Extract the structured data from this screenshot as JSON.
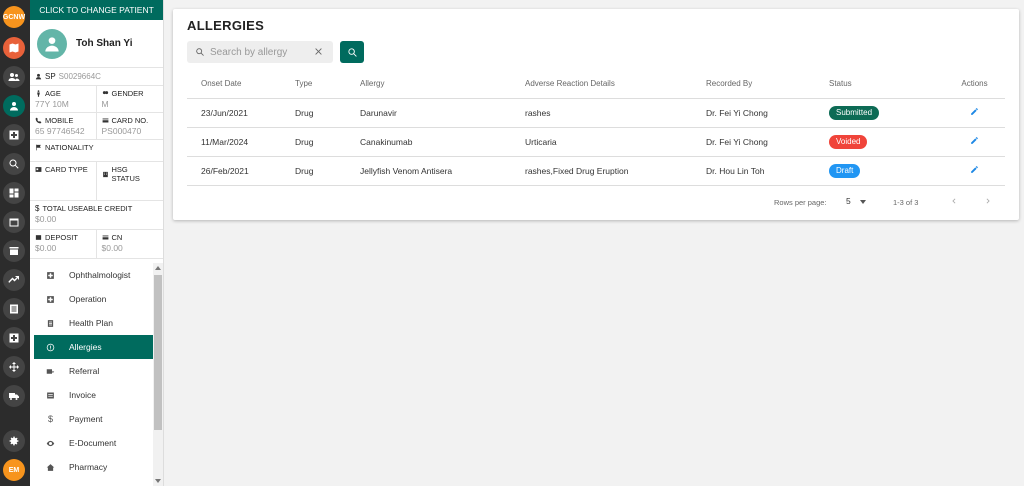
{
  "rail": {
    "top_badge": "GCNW",
    "user_badge": "EM",
    "icons": [
      "map-icon",
      "people-icon",
      "person-icon",
      "medical-plus-icon",
      "search-icon",
      "dashboard-icon",
      "calendar-icon",
      "store-icon",
      "trending-icon",
      "list-icon",
      "hospital-icon",
      "move-icon",
      "truck-icon",
      "settings-icon"
    ]
  },
  "patient": {
    "change_label": "CLICK TO CHANGE PATIENT",
    "name": "Toh Shan Yi",
    "sp_label": "SP",
    "sp_value": "S0029664C",
    "age_label": "AGE",
    "age_value": "77Y 10M",
    "gender_label": "GENDER",
    "gender_value": "M",
    "mobile_label": "MOBILE",
    "mobile_value": "65 97746542",
    "card_no_label": "CARD NO.",
    "card_no_value": "PS000470",
    "nationality_label": "NATIONALITY",
    "card_type_label": "CARD TYPE",
    "hsg_status_label": "HSG STATUS",
    "credit_label": "TOTAL USEABLE CREDIT",
    "credit_value": "$0.00",
    "deposit_label": "DEPOSIT",
    "deposit_value": "$0.00",
    "cn_label": "CN",
    "cn_value": "$0.00"
  },
  "menu": [
    {
      "label": "Ophthalmologist",
      "icon": "medical-plus-icon"
    },
    {
      "label": "Operation",
      "icon": "medical-plus-icon"
    },
    {
      "label": "Health Plan",
      "icon": "clipboard-icon"
    },
    {
      "label": "Allergies",
      "icon": "alert-circle-icon",
      "active": true
    },
    {
      "label": "Referral",
      "icon": "referral-icon"
    },
    {
      "label": "Invoice",
      "icon": "invoice-icon"
    },
    {
      "label": "Payment",
      "icon": "dollar-icon"
    },
    {
      "label": "E-Document",
      "icon": "eye-icon"
    },
    {
      "label": "Pharmacy",
      "icon": "home-icon"
    }
  ],
  "main": {
    "title": "ALLERGIES",
    "search_placeholder": "Search by allergy",
    "columns": [
      "Onset Date",
      "Type",
      "Allergy",
      "Adverse Reaction Details",
      "Recorded By",
      "Status",
      "Actions"
    ],
    "rows": [
      {
        "onset": "23/Jun/2021",
        "type": "Drug",
        "allergy": "Darunavir",
        "reaction": "rashes",
        "recorded_by": "Dr. Fei Yi Chong",
        "status": "Submitted"
      },
      {
        "onset": "11/Mar/2024",
        "type": "Drug",
        "allergy": "Canakinumab",
        "reaction": "Urticaria",
        "recorded_by": "Dr. Fei Yi Chong",
        "status": "Voided"
      },
      {
        "onset": "26/Feb/2021",
        "type": "Drug",
        "allergy": "Jellyfish Venom Antisera",
        "reaction": "rashes,Fixed Drug Eruption",
        "recorded_by": "Dr. Hou Lin Toh",
        "status": "Draft"
      }
    ],
    "status_colors": {
      "Submitted": "#0d6b55",
      "Voided": "#f0443a",
      "Draft": "#2196f3"
    },
    "pager": {
      "rows_per_page_label": "Rows per page:",
      "rows_per_page_value": "5",
      "range": "1-3 of 3"
    }
  },
  "colors": {
    "accent": "#006b5e",
    "rail": "#2c2c2c",
    "badge_orange": "#f7941d"
  }
}
